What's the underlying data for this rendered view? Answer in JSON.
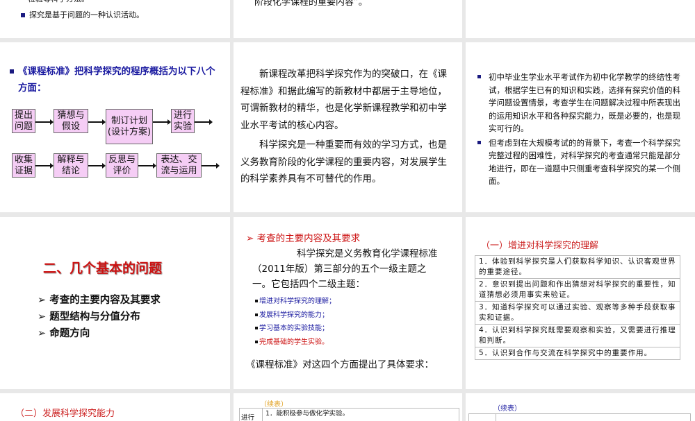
{
  "slides": {
    "s0a": {
      "cut_line": "检验等科学方法。",
      "bullet": "探究是基于问题的一种认识活动。"
    },
    "s0b": {
      "cut_line": "阶段化学课程的重要内容”。"
    },
    "s1": {
      "heading": "《课程标准》把科学探究的程序概括为以下八个方面：",
      "steps": [
        "提出问题",
        "猜想与假设",
        "制订计划(设计方案)",
        "进行实验",
        "收集证据",
        "解释与结论",
        "反思与评价",
        "表达、交流与运用"
      ]
    },
    "s2": {
      "p1": "新课程改革把科学探究作为的突破口，在《课程标准》和据此编写的新教材中都居于主导地位，可谓新教材的精华，也是化学新课程教学和初中学业水平考试的核心内容。",
      "p2": "科学探究是一种重要而有效的学习方式，也是义务教育阶段的化学课程的重要内容，对发展学生的科学素养具有不可替代的作用。"
    },
    "s3": {
      "bullets": [
        "初中毕业生学业水平考试作为初中化学教学的终结性考试，根据学生已有的知识和实践，选择有探究价值的科学问题设置情景，考查学生在问题解决过程中所表现出的运用知识水平和各种探究能力，既是必要的，也是现实可行的。",
        "但考虑到在大规模考试的的背景下，考查一个科学探究完整过程的困难性，对科学探究的考查通常只能是部分地进行，即在一道题中只侧重考查科学探究的某一个侧面。"
      ]
    },
    "s4": {
      "title": "二、几个基本的问题",
      "items": [
        "考查的主要内容及其要求",
        "题型结构与分值分布",
        "命题方向"
      ]
    },
    "s5": {
      "heading": "考查的主要内容及其要求",
      "para": "科学探究是义务教育化学课程标准（2011年版）第三部分的五个一级主题之一。它包括四个二级主题：",
      "subs": [
        "增进对科学探究的理解；",
        "发展科学探究的能力；",
        "学习基本的实验技能；",
        "完成基础的学生实验。"
      ],
      "footer": "《课程标准》对这四个方面提出了具体要求："
    },
    "s6": {
      "heading": "（一）增进对科学探究的理解",
      "rows": [
        "1．体验到科学探究是人们获取科学知识、认识客观世界的重要途径。",
        "2．意识到提出问题和作出猜想对科学探究的重要性，知道猜想必须用事实来验证。",
        "3．知道科学探究可以通过实验、观察等多种手段获取事实和证据。",
        "4．认识到科学探究既需要观察和实验，又需要进行推理和判断。",
        "5．认识到合作与交流在科学探究中的重要作用。"
      ]
    },
    "s7": {
      "heading": "（二）发展科学探究能力"
    },
    "s8": {
      "label": "（续表）",
      "row_head": "进行",
      "row_text": "1．能积极参与做化学实验。"
    },
    "s9": {
      "label": "（续表）"
    }
  },
  "colors": {
    "bg": "#e8e8e8",
    "blue_text": "#1a1aa0",
    "red_text": "#cc1111",
    "box_fill": "#f5cdf5"
  }
}
